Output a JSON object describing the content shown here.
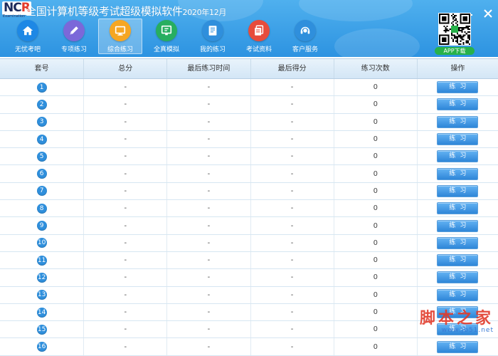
{
  "app": {
    "logo_text": "NCR",
    "logo_sub": "Examination",
    "title": "全国计算机等级考试超级模拟软件",
    "version": "2020年12月"
  },
  "nav": [
    {
      "label": "无忧考吧",
      "icon": "home-icon",
      "color": "#1e88e5"
    },
    {
      "label": "专项练习",
      "icon": "pencil-icon",
      "color": "#7b68d9"
    },
    {
      "label": "综合练习",
      "icon": "monitor-icon",
      "color": "#f5a623",
      "active": true
    },
    {
      "label": "全真模拟",
      "icon": "exam-screen-icon",
      "color": "#27ae60"
    },
    {
      "label": "我的练习",
      "icon": "document-icon",
      "color": "#2f8fdc"
    },
    {
      "label": "考试资料",
      "icon": "copy-docs-icon",
      "color": "#e74c3c"
    },
    {
      "label": "客户服务",
      "icon": "headset-icon",
      "color": "#2f8fdc"
    }
  ],
  "app_download": "APP下载",
  "table": {
    "headers": [
      "套号",
      "总分",
      "最后练习时间",
      "最后得分",
      "练习次数",
      "操作"
    ],
    "button_label": "练习",
    "rows": [
      {
        "id": "1",
        "total": "-",
        "last_time": "-",
        "last_score": "-",
        "count": "0"
      },
      {
        "id": "2",
        "total": "-",
        "last_time": "-",
        "last_score": "-",
        "count": "0"
      },
      {
        "id": "3",
        "total": "-",
        "last_time": "-",
        "last_score": "-",
        "count": "0"
      },
      {
        "id": "4",
        "total": "-",
        "last_time": "-",
        "last_score": "-",
        "count": "0"
      },
      {
        "id": "5",
        "total": "-",
        "last_time": "-",
        "last_score": "-",
        "count": "0"
      },
      {
        "id": "6",
        "total": "-",
        "last_time": "-",
        "last_score": "-",
        "count": "0"
      },
      {
        "id": "7",
        "total": "-",
        "last_time": "-",
        "last_score": "-",
        "count": "0"
      },
      {
        "id": "8",
        "total": "-",
        "last_time": "-",
        "last_score": "-",
        "count": "0"
      },
      {
        "id": "9",
        "total": "-",
        "last_time": "-",
        "last_score": "-",
        "count": "0"
      },
      {
        "id": "10",
        "total": "-",
        "last_time": "-",
        "last_score": "-",
        "count": "0"
      },
      {
        "id": "11",
        "total": "-",
        "last_time": "-",
        "last_score": "-",
        "count": "0"
      },
      {
        "id": "12",
        "total": "-",
        "last_time": "-",
        "last_score": "-",
        "count": "0"
      },
      {
        "id": "13",
        "total": "-",
        "last_time": "-",
        "last_score": "-",
        "count": "0"
      },
      {
        "id": "14",
        "total": "-",
        "last_time": "-",
        "last_score": "-",
        "count": "0"
      },
      {
        "id": "15",
        "total": "-",
        "last_time": "-",
        "last_score": "-",
        "count": "0"
      },
      {
        "id": "16",
        "total": "-",
        "last_time": "-",
        "last_score": "-",
        "count": "0"
      }
    ]
  },
  "watermark": {
    "main": "脚本之家",
    "sub": "www.jb51.net"
  }
}
